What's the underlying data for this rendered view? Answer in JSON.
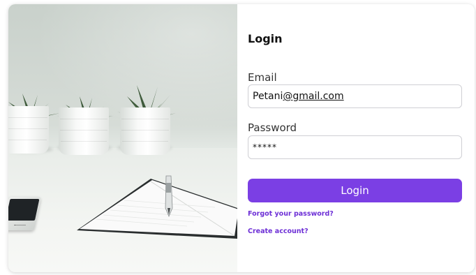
{
  "form": {
    "title": "Login",
    "email_label": "Email",
    "email_value_prefix": "Petani",
    "email_value_rest": "@gmail.com",
    "password_label": "Password",
    "password_value": "*****",
    "login_button": "Login",
    "forgot_password_link": "Forgot your password?",
    "create_account_link": "Create account?"
  },
  "colors": {
    "accent": "#7b3fe4",
    "link": "#6d2fd6"
  },
  "image": {
    "icons": [
      "succulent-plant",
      "white-planter-pot",
      "open-notebook",
      "pen",
      "smartphone"
    ]
  }
}
